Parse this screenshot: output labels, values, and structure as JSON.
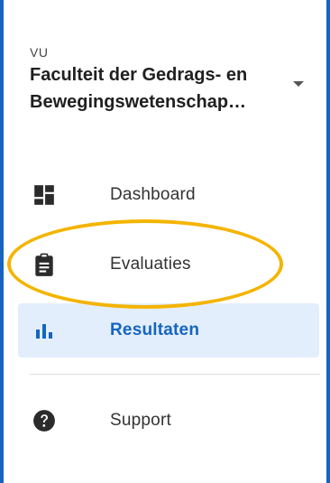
{
  "org": {
    "short": "VU",
    "name": "Faculteit der Gedrags- en Bewegingswetenschap…"
  },
  "nav": {
    "items": [
      {
        "label": "Dashboard",
        "icon": "dashboard-icon"
      },
      {
        "label": "Evaluaties",
        "icon": "clipboard-icon"
      },
      {
        "label": "Resultaten",
        "icon": "bar-chart-icon",
        "active": true
      },
      {
        "label": "Support",
        "icon": "help-icon"
      }
    ]
  },
  "colors": {
    "accent": "#1565c0",
    "active_background": "#e3eefc",
    "highlight": "#f4b400"
  }
}
